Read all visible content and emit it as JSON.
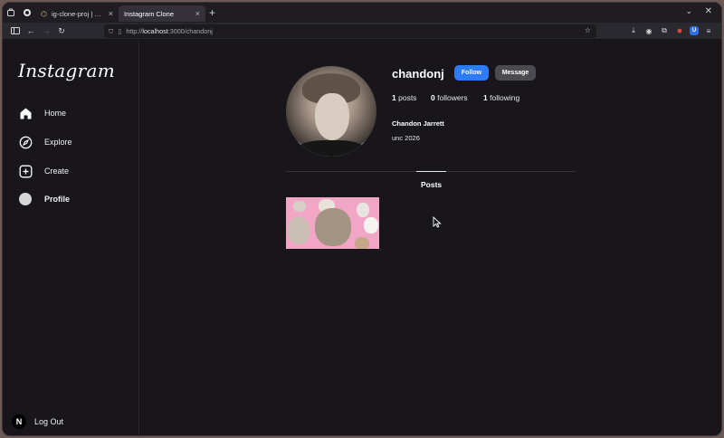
{
  "browser": {
    "tabs": [
      {
        "label": "ig-clone-proj | Chandon",
        "active": false
      },
      {
        "label": "Instagram Clone",
        "active": true
      }
    ],
    "url_prefix": "http://",
    "url_host": "localhost",
    "url_rest": ":3000/chandonj"
  },
  "sidebar": {
    "logo": "Instagram",
    "items": [
      {
        "label": "Home",
        "icon": "home-icon"
      },
      {
        "label": "Explore",
        "icon": "compass-icon"
      },
      {
        "label": "Create",
        "icon": "plus-square-icon"
      },
      {
        "label": "Profile",
        "icon": "avatar-icon"
      }
    ],
    "logout_label": "Log Out",
    "logout_badge": "N"
  },
  "profile": {
    "username": "chandonj",
    "follow_label": "Follow",
    "message_label": "Message",
    "stats": {
      "posts_count": "1",
      "posts_label": "posts",
      "followers_count": "0",
      "followers_label": "followers",
      "following_count": "1",
      "following_label": "following"
    },
    "full_name": "Chandon Jarrett",
    "bio": "unc 2026",
    "tab_label": "Posts"
  }
}
